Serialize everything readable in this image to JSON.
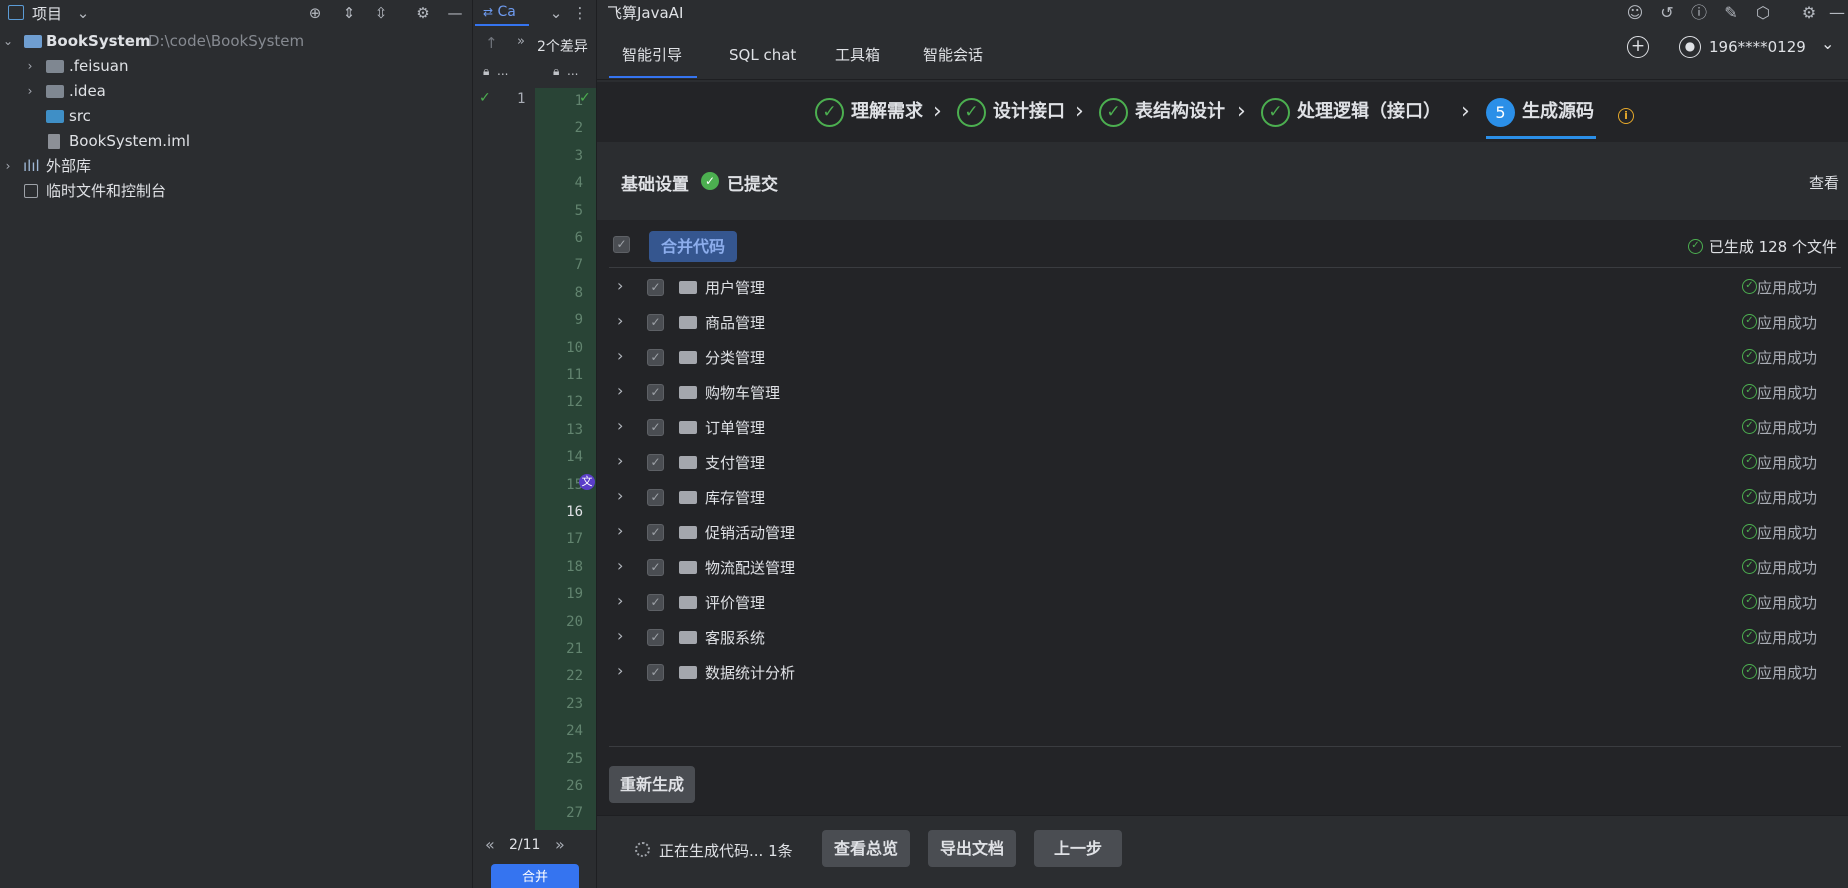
{
  "project": {
    "title": "项目",
    "tree": [
      {
        "name": "BookSystem",
        "path": "D:\\code\\BookSystem",
        "icon": "module-folder-icon"
      },
      {
        "name": ".feisuan",
        "icon": "folder-icon"
      },
      {
        "name": ".idea",
        "icon": "folder-icon"
      },
      {
        "name": "src",
        "icon": "source-folder-icon"
      },
      {
        "name": "BookSystem.iml",
        "icon": "iml-file-icon"
      },
      {
        "name": "外部库",
        "icon": "library-icon"
      },
      {
        "name": "临时文件和控制台",
        "icon": "scratch-icon"
      }
    ]
  },
  "diff": {
    "tab_label": "Ca",
    "diff_count": "2个差异",
    "lock_dots": "...",
    "line_numbers": [
      "1",
      "2",
      "3",
      "4",
      "5",
      "6",
      "7",
      "8",
      "9",
      "10",
      "11",
      "12",
      "13",
      "14",
      "15",
      "16",
      "17",
      "18",
      "19",
      "20",
      "21",
      "22",
      "23",
      "24",
      "25",
      "26",
      "27"
    ],
    "left_line": "1",
    "nav": "2/11",
    "merge_label": "合并"
  },
  "ai": {
    "title": "飞算JavaAI",
    "tabs": [
      "智能引导",
      "SQL chat",
      "工具箱",
      "智能会话"
    ],
    "account": "196****0129",
    "steps": [
      {
        "label": "理解需求",
        "done": true
      },
      {
        "label": "设计接口",
        "done": true
      },
      {
        "label": "表结构设计",
        "done": true
      },
      {
        "label": "处理逻辑（接口）",
        "done": true
      },
      {
        "label": "生成源码",
        "done": false,
        "number": "5"
      }
    ],
    "basic": {
      "title": "基础设置",
      "status": "已提交",
      "view": "查看"
    },
    "toolbar": {
      "merge_code": "合并代码",
      "generated": "已生成 128 个文件"
    },
    "modules": [
      {
        "name": "用户管理",
        "status": "应用成功"
      },
      {
        "name": "商品管理",
        "status": "应用成功"
      },
      {
        "name": "分类管理",
        "status": "应用成功"
      },
      {
        "name": "购物车管理",
        "status": "应用成功"
      },
      {
        "name": "订单管理",
        "status": "应用成功"
      },
      {
        "name": "支付管理",
        "status": "应用成功"
      },
      {
        "name": "库存管理",
        "status": "应用成功"
      },
      {
        "name": "促销活动管理",
        "status": "应用成功"
      },
      {
        "name": "物流配送管理",
        "status": "应用成功"
      },
      {
        "name": "评价管理",
        "status": "应用成功"
      },
      {
        "name": "客服系统",
        "status": "应用成功"
      },
      {
        "name": "数据统计分析",
        "status": "应用成功"
      }
    ],
    "regenerate": "重新生成",
    "bottom": {
      "status": "正在生成代码... 1条",
      "view_overview": "查看总览",
      "export_doc": "导出文档",
      "prev_step": "上一步"
    }
  },
  "colors": {
    "accent": "#3574f0",
    "success": "#4caf50",
    "step_active": "#2b8fe8",
    "warning": "#e5a82a"
  }
}
